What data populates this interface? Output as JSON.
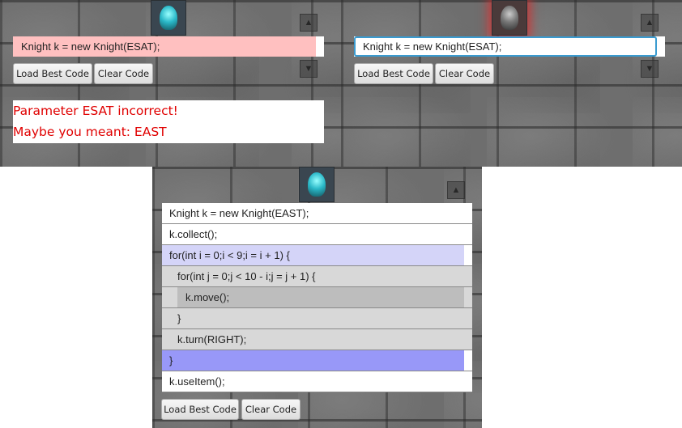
{
  "left_panel": {
    "code_line": "Knight k = new Knight(ESAT);",
    "load_button": "Load Best Code",
    "clear_button": "Clear Code",
    "error_line_1": "Parameter ESAT incorrect!",
    "error_line_2": "Maybe you meant: EAST"
  },
  "right_panel": {
    "code_line": "Knight k = new Knight(ESAT);",
    "load_button": "Load Best Code",
    "clear_button": "Clear Code"
  },
  "bottom_panel": {
    "lines": [
      "Knight k = new Knight(EAST);",
      "k.collect();",
      "for(int i = 0;i < 9;i = i + 1) {",
      "for(int j = 0;j < 10 - i;j = j + 1) {",
      "k.move();",
      "}",
      "k.turn(RIGHT);",
      "}",
      "k.useItem();"
    ],
    "load_button": "Load Best Code",
    "clear_button": "Clear Code"
  },
  "colors": {
    "error_background": "#ffc0c0",
    "error_text": "#e00000",
    "outer_loop_block": "#d4d4f8",
    "outer_loop_end": "#9898f8",
    "inner_block": "#d8d8d8",
    "innermost_block": "#bdbdbd",
    "focus_border": "#3a9bd0"
  },
  "icons": [
    "knight-icon",
    "arrow-up-icon",
    "arrow-down-icon"
  ]
}
